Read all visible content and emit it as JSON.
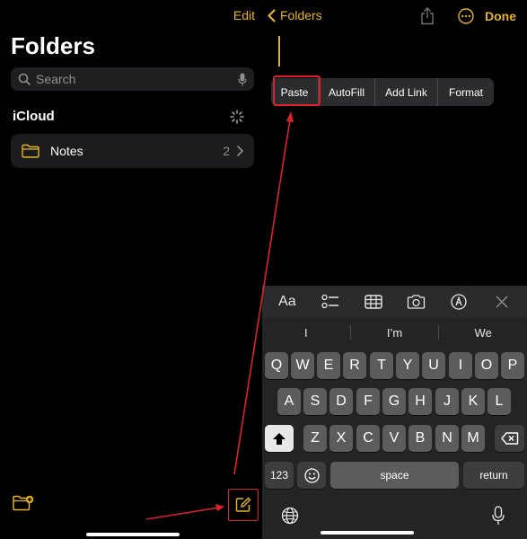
{
  "left": {
    "edit_label": "Edit",
    "title": "Folders",
    "search_placeholder": "Search",
    "section": "iCloud",
    "folders": [
      {
        "name": "Notes",
        "count": "2"
      }
    ]
  },
  "right": {
    "back_label": "Folders",
    "done_label": "Done",
    "edit_menu": [
      "Paste",
      "AutoFill",
      "Add Link",
      "Format"
    ],
    "keyboard": {
      "toolbar": {
        "format_label": "Aa"
      },
      "predictions": [
        "I",
        "I’m",
        "We"
      ],
      "row1": [
        "Q",
        "W",
        "E",
        "R",
        "T",
        "Y",
        "U",
        "I",
        "O",
        "P"
      ],
      "row2": [
        "A",
        "S",
        "D",
        "F",
        "G",
        "H",
        "J",
        "K",
        "L"
      ],
      "row3": [
        "Z",
        "X",
        "C",
        "V",
        "B",
        "N",
        "M"
      ],
      "numbers_label": "123",
      "space_label": "space",
      "return_label": "return"
    }
  },
  "colors": {
    "accent": "#e6b422",
    "annotation": "#e0202a",
    "background": "#000000"
  }
}
